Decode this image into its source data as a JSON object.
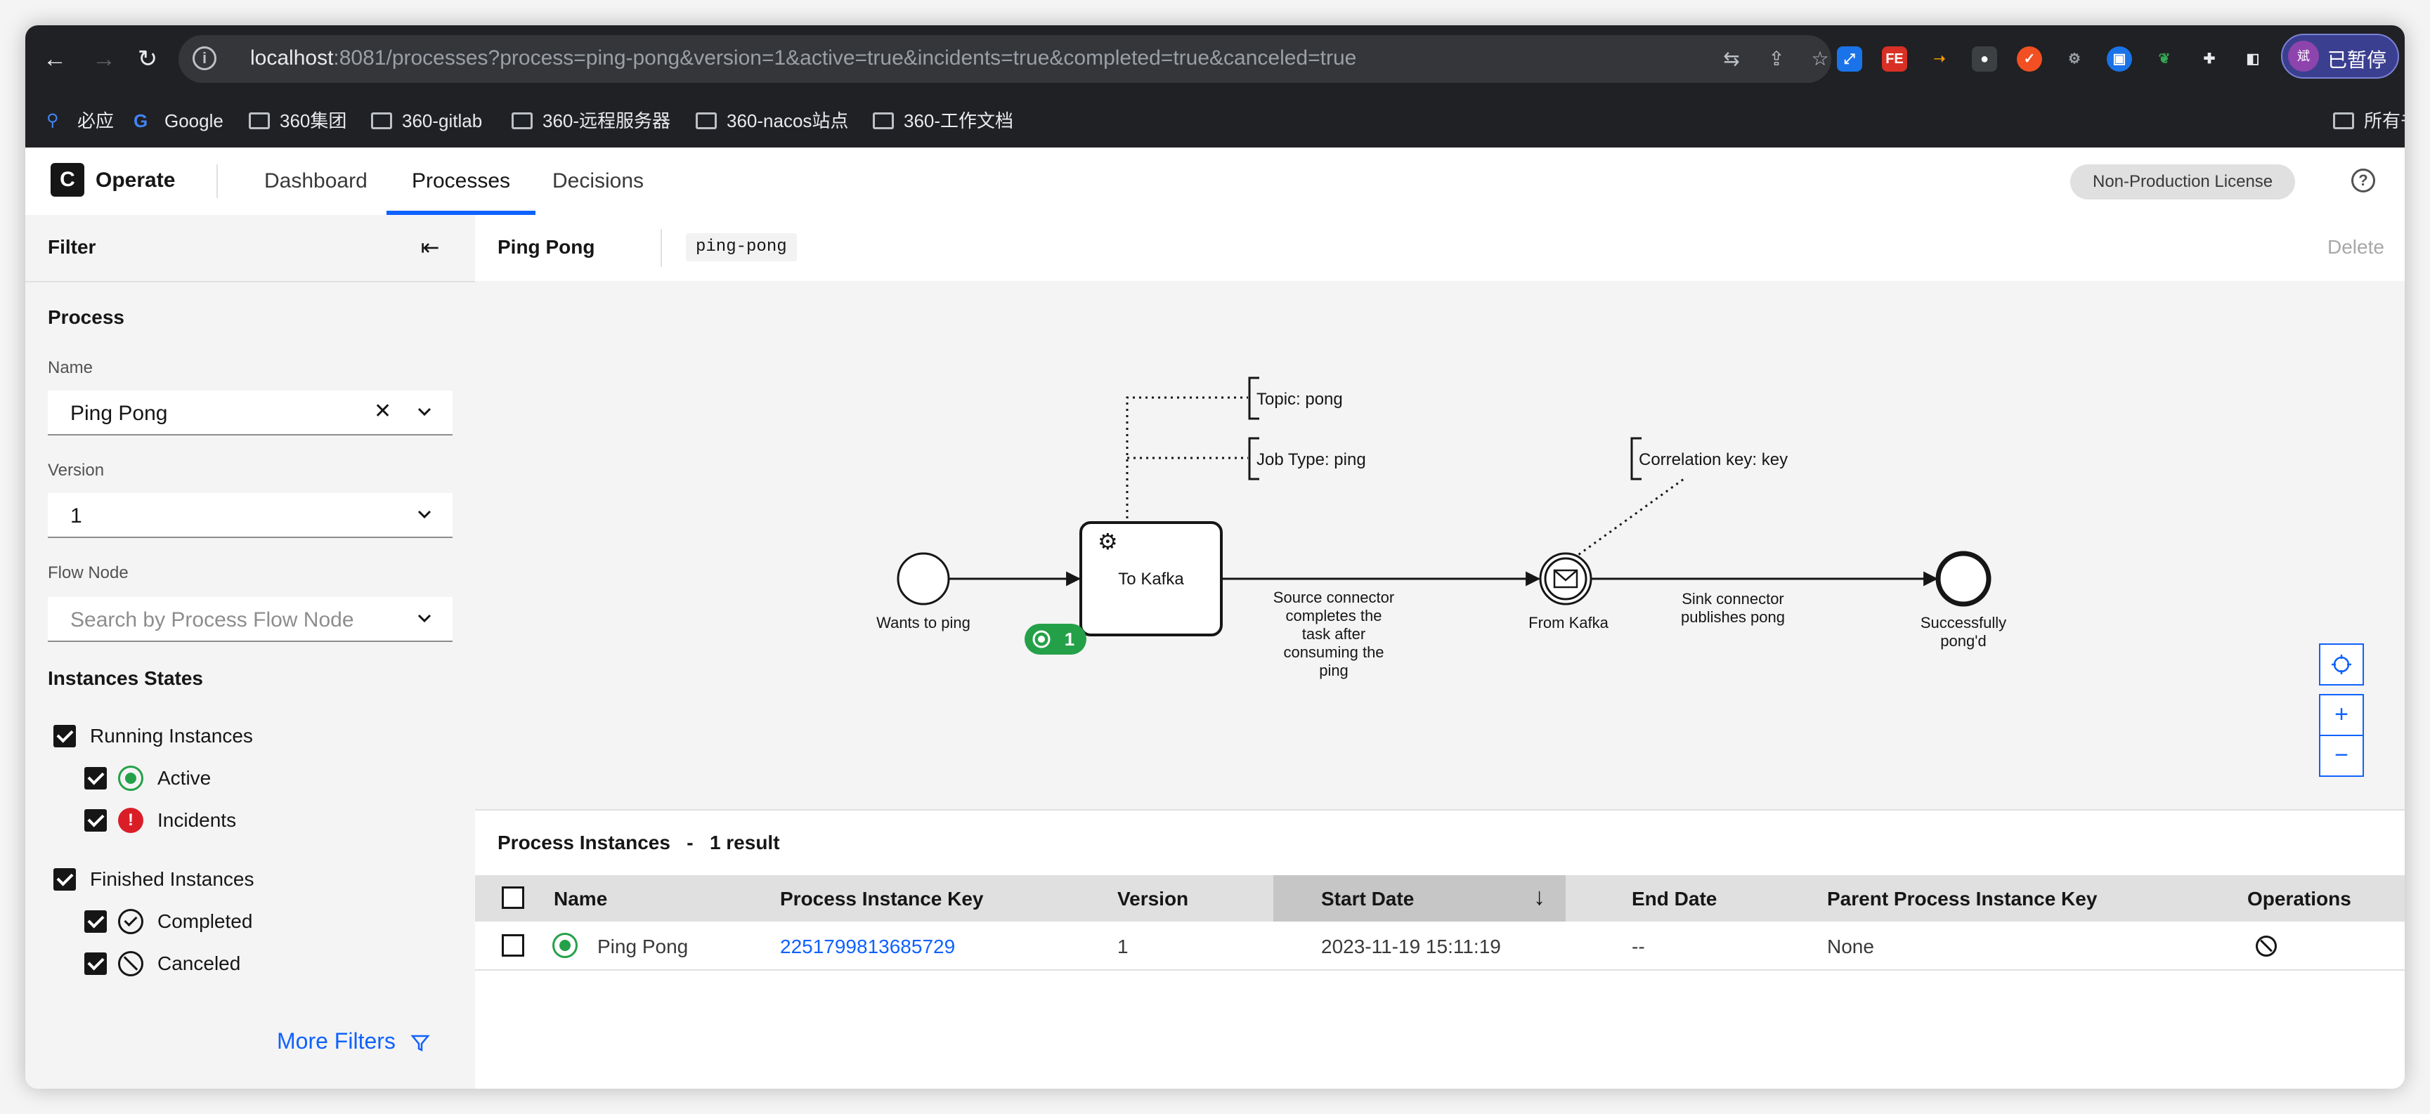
{
  "browser": {
    "url_host": "localhost",
    "url_rest": ":8081/processes?process=ping-pong&version=1&active=true&incidents=true&completed=true&canceled=true",
    "profile_label": "已暂停",
    "profile_avatar": "斌",
    "bookmarks": [
      "必应",
      "Google",
      "360集团",
      "360-gitlab",
      "360-远程服务器",
      "360-nacos站点",
      "360-工作文档"
    ],
    "bookmarks_right": "所有书"
  },
  "app": {
    "brand": "Operate",
    "logo_letter": "C",
    "nav": [
      "Dashboard",
      "Processes",
      "Decisions"
    ],
    "license": "Non-Production License",
    "help": "?"
  },
  "filter": {
    "title": "Filter",
    "process_section": "Process",
    "name_label": "Name",
    "name_value": "Ping Pong",
    "version_label": "Version",
    "version_value": "1",
    "flow_node_label": "Flow Node",
    "flow_node_placeholder": "Search by Process Flow Node",
    "states_section": "Instances States",
    "running": "Running Instances",
    "active": "Active",
    "incidents": "Incidents",
    "incident_mark": "!",
    "finished": "Finished Instances",
    "completed": "Completed",
    "canceled": "Canceled",
    "more_filters": "More Filters"
  },
  "process_header": {
    "name": "Ping Pong",
    "id": "ping-pong",
    "delete": "Delete"
  },
  "diagram": {
    "start_label": "Wants to ping",
    "task_label": "To Kafka",
    "badge_count": "1",
    "flow1_label": [
      "Source connector",
      "completes the",
      "task after",
      "consuming the",
      "ping"
    ],
    "catch_label": "From Kafka",
    "flow2_label": [
      "Sink connector",
      "publishes pong"
    ],
    "end_label": [
      "Successfully",
      "pong'd"
    ],
    "annotation_topic": "Topic: pong",
    "annotation_job": "Job Type: ping",
    "annotation_corr": "Correlation key: key",
    "zoom_in": "+",
    "zoom_out": "−"
  },
  "instances": {
    "title": "Process Instances",
    "separator": "-",
    "count": "1 result",
    "columns": [
      "Name",
      "Process Instance Key",
      "Version",
      "Start Date",
      "End Date",
      "Parent Process Instance Key",
      "Operations"
    ],
    "rows": [
      {
        "name": "Ping Pong",
        "key": "2251799813685729",
        "version": "1",
        "start": "2023-11-19 15:11:19",
        "end": "--",
        "parent": "None"
      }
    ]
  }
}
